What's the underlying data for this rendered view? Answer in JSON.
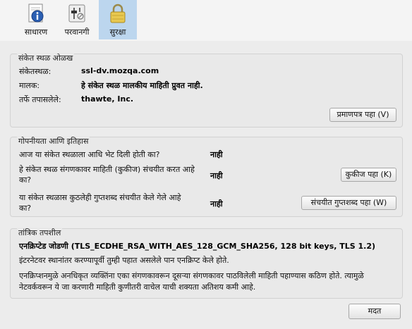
{
  "tabs": [
    {
      "label": "साधारण",
      "icon": "info-icon"
    },
    {
      "label": "परवानगी",
      "icon": "permissions-icon"
    },
    {
      "label": "सुरक्षा",
      "icon": "lock-icon"
    }
  ],
  "identity": {
    "title": "संकेत स्थळ ओळख",
    "site_label": "संकेतस्थळ:",
    "site_value": "ssl-dv.mozqa.com",
    "owner_label": "मालक:",
    "owner_value": "हे संकेत स्थळ मालकीय माहिती प्रुवत नाही.",
    "verifier_label": "तर्फे तपासलेले:",
    "verifier_value": "thawte, Inc.",
    "view_cert_button": "प्रमाणपत्र पहा (V)"
  },
  "privacy": {
    "title": "गोपनीयता आणि इतिहास",
    "q1": "आज या संकेत स्थळाला आधि भेट दिली होती का?",
    "a1": "नाही",
    "q2": "हे संकेत स्थळ संगणकावर माहिती (कुकीज) संचयीत करत आहे का?",
    "a2": "नाही",
    "cookies_button": "कुकीज पहा (K)",
    "q3": "या संकेत स्थळास कुठलेही गुप्तशब्द संचयीत केले गेले आहे का?",
    "a3": "नाही",
    "passwords_button": "संचयीत गुप्तशब्द पहा (W)"
  },
  "technical": {
    "title": "तांत्रिक तपशील",
    "cipher": "एनक्रिप्टेड जोडणी (TLS_ECDHE_RSA_WITH_AES_128_GCM_SHA256, 128 bit keys, TLS 1.2)",
    "line1": "इंटरनेटवर स्थानांतर करण्यापूर्वी तुम्ही पहात असलेले पान एनक्रिप्ट केले होते.",
    "line2": "एनक्रिप्शनमुळे अनधिकृत व्यक्तिंना एका संगणकावरून दूसऱ्या संगणकावर पाठविलेली माहिती पहाण्यास कठिण होते. त्यामुळे नेटवर्कवरून ये जा करणारी माहिती कुणीतरी वाचेल याची शक्यता अतिशय कमी आहे."
  },
  "help_button": "मदत"
}
